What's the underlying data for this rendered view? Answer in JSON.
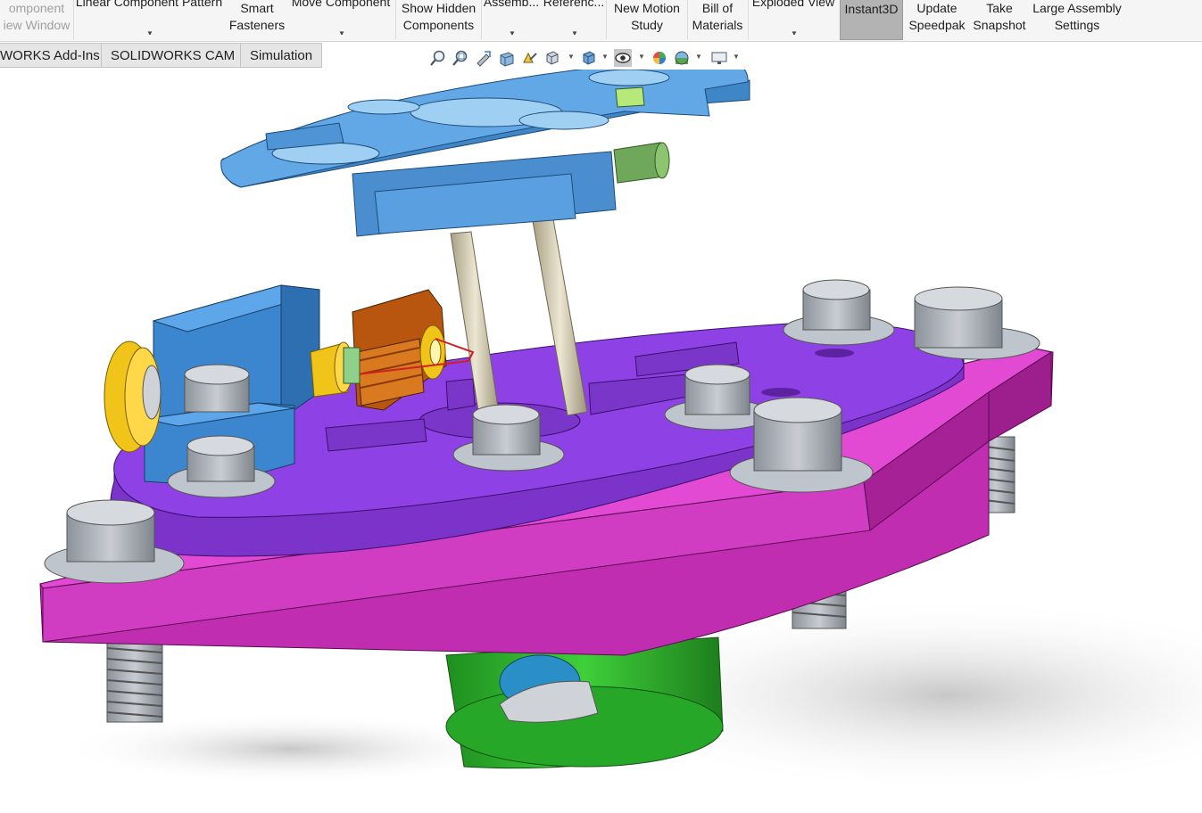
{
  "ribbon": {
    "items": [
      {
        "l1": "omponent",
        "l2": "iew Window",
        "dim": true
      },
      {
        "l1": "Linear Component Pattern",
        "l2": ""
      },
      {
        "l1": "Smart",
        "l2": "Fasteners"
      },
      {
        "l1": "Move Component",
        "l2": ""
      },
      {
        "l1": "Show Hidden",
        "l2": "Components"
      },
      {
        "l1": "Assemb...",
        "l2": ""
      },
      {
        "l1": "Referenc...",
        "l2": ""
      },
      {
        "l1": "New Motion",
        "l2": "Study"
      },
      {
        "l1": "Bill of",
        "l2": "Materials"
      },
      {
        "l1": "Exploded View",
        "l2": ""
      },
      {
        "l1": "Instant3D",
        "l2": "",
        "active": true
      },
      {
        "l1": "Update",
        "l2": "Speedpak"
      },
      {
        "l1": "Take",
        "l2": "Snapshot"
      },
      {
        "l1": "Large Assembly",
        "l2": "Settings"
      }
    ]
  },
  "tabs": [
    {
      "label": "WORKS Add-Ins"
    },
    {
      "label": "SOLIDWORKS CAM"
    },
    {
      "label": "Simulation"
    }
  ],
  "heads_up_toolbar": {
    "icons": [
      "zoom-to-fit-icon",
      "zoom-to-area-icon",
      "previous-view-icon",
      "section-view-icon",
      "dynamic-annotation-icon",
      "view-orientation-icon",
      "display-style-icon",
      "hide-show-items-icon",
      "edit-appearance-icon",
      "apply-scene-icon",
      "view-settings-icon"
    ]
  },
  "colors": {
    "top_plate": "#5aa6e3",
    "mid_plate": "#8c3fe0",
    "base_plate": "#d634c4",
    "motor_body": "#2fb52f",
    "bracket": "#4d95db",
    "coil": "#b8550f",
    "knob": "#f0c419",
    "bolt": "#a8adb5",
    "rod": "#d8d0b8"
  }
}
